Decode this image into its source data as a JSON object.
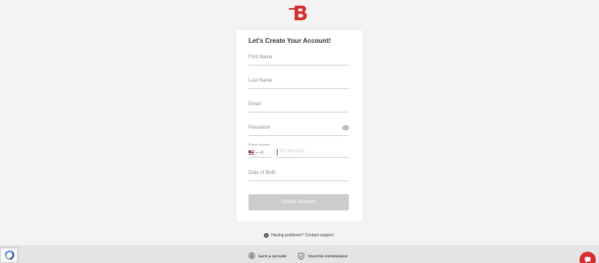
{
  "brand": {
    "logo_icon": "brand-b-logo-icon",
    "accent": "#d62c2c"
  },
  "form": {
    "title": "Let's Create Your Account!",
    "first_name_placeholder": "First Name",
    "last_name_placeholder": "Last Name",
    "email_placeholder": "Email",
    "password_placeholder": "Password",
    "password_toggle_icon": "eye-icon",
    "phone_label": "Phone Number",
    "country_code": "+1",
    "country_flag": "us-flag-icon",
    "phone_placeholder": "201-555-0123",
    "dob_placeholder": "Date of Birth",
    "submit_label": "Create Account",
    "submit_color": "#cccccc"
  },
  "help": {
    "icon": "question-icon",
    "text": "Having problems? Contact support"
  },
  "footer": {
    "badges": [
      {
        "icon": "lock-icon",
        "label": "SAFE & SECURE"
      },
      {
        "icon": "shield-check-icon",
        "label": "TRUSTED EXPERIENCE"
      }
    ]
  },
  "widgets": {
    "recaptcha_icon": "recaptcha-icon",
    "chat_icon": "chat-icon"
  }
}
